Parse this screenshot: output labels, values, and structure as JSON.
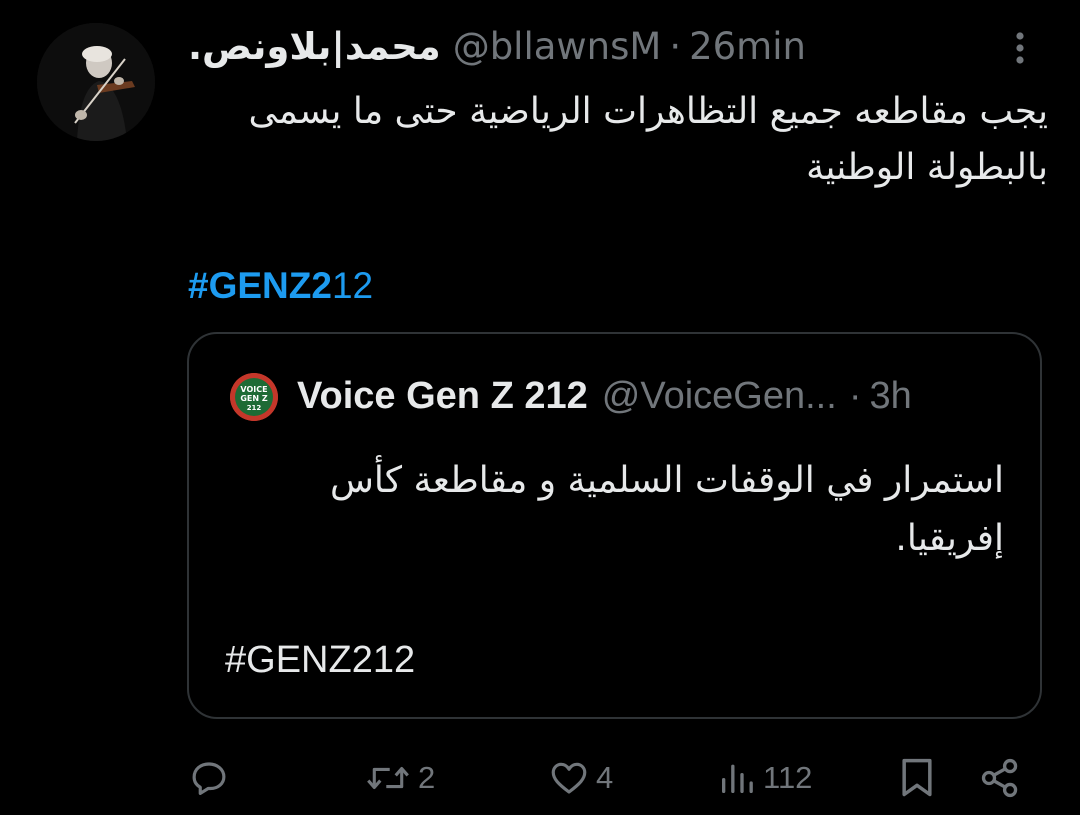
{
  "tweet": {
    "display_name": "محمد|بلاونص.",
    "handle": "@bllawnsM",
    "separator": "·",
    "time": "26min",
    "text": "يجب مقاطعه جميع التظاهرات الرياضية حتى ما يسمى بالبطولة الوطنية",
    "hashtag_bold": "#GENZ2",
    "hashtag_rest": "12"
  },
  "quote": {
    "name": "Voice Gen Z 212",
    "handle": "@VoiceGen...",
    "separator": "·",
    "time": "3h",
    "text": "استمرار في الوقفات السلمية و مقاطعة كأس إفريقيا.",
    "hashtag": "#GENZ212",
    "avatar_text_line1": "VOICE",
    "avatar_text_line2": "GEN Z",
    "avatar_text_line3": "212"
  },
  "actions": {
    "reply_icon": "reply-icon",
    "retweet_count": "2",
    "like_count": "4",
    "views_count": "112",
    "bookmark_icon": "bookmark-icon",
    "share_icon": "share-icon"
  },
  "colors": {
    "background": "#000000",
    "text": "#e7e9ea",
    "muted": "#71767b",
    "link": "#1d9bf0",
    "border": "#2f3336"
  }
}
